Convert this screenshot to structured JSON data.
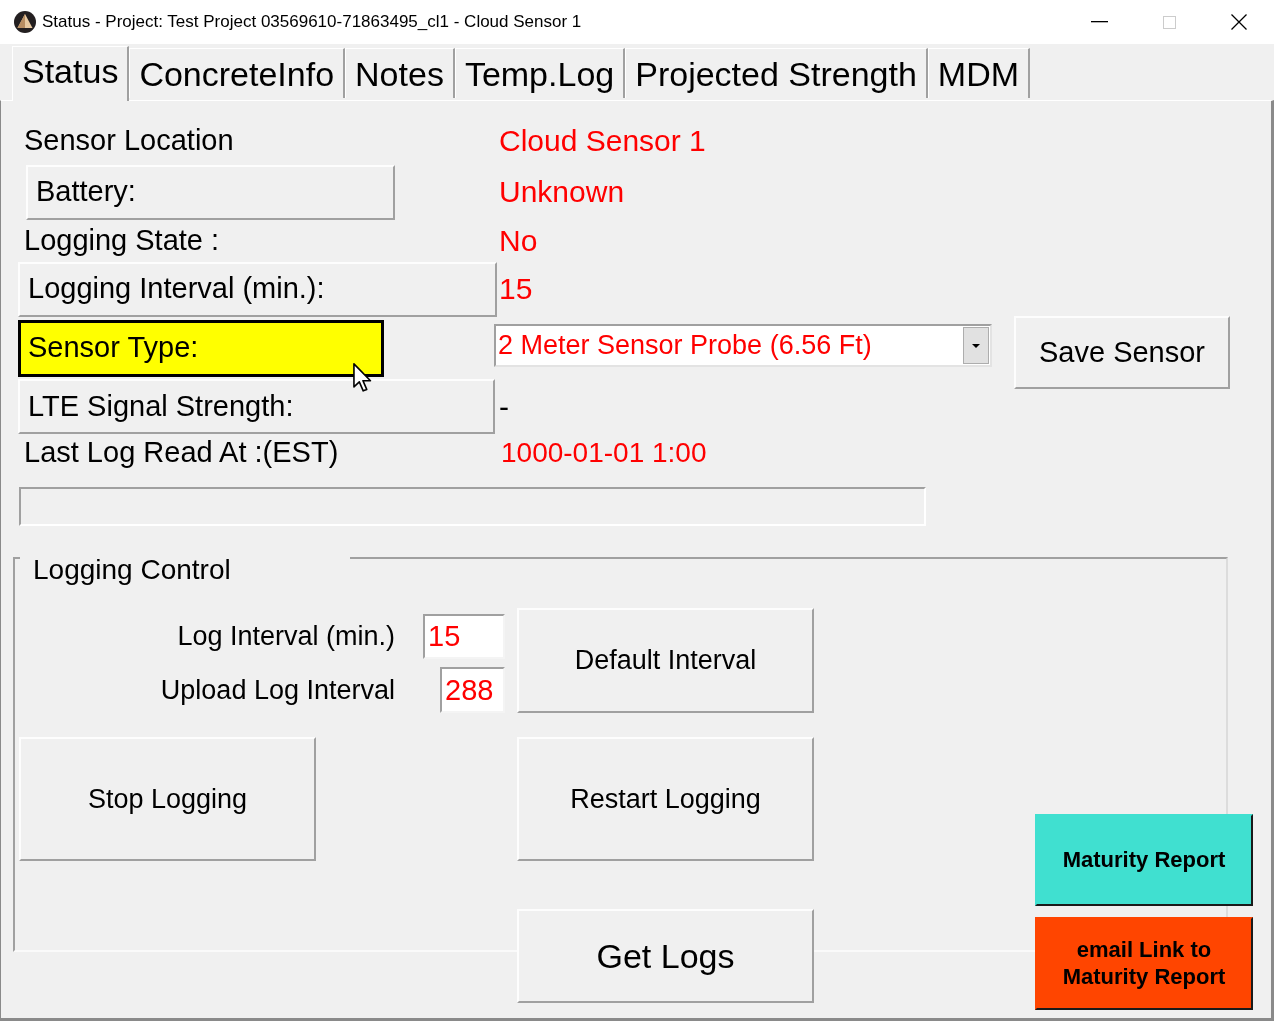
{
  "window": {
    "title": "Status - Project: Test Project 03569610-71863495_cl1 - Cloud Sensor 1",
    "maximize": {
      "disabled": true
    }
  },
  "tabs": [
    {
      "label": "Status",
      "selected": true
    },
    {
      "label": "ConcreteInfo",
      "selected": false
    },
    {
      "label": "Notes",
      "selected": false
    },
    {
      "label": "Temp.Log",
      "selected": false
    },
    {
      "label": "Projected Strength",
      "selected": false
    },
    {
      "label": "MDM",
      "selected": false
    }
  ],
  "sensor_rows": [
    {
      "kind": "text",
      "label": "Sensor Location",
      "value": "Cloud Sensor 1",
      "color": "#ff0000"
    },
    {
      "kind": "button",
      "label": "Battery:",
      "highlighted": false,
      "value": "Unknown",
      "color": "#ff0000"
    },
    {
      "kind": "text",
      "label": "Logging State :",
      "value": "No",
      "color": "#ff0000"
    },
    {
      "kind": "button",
      "label": "Logging Interval (min.):",
      "highlighted": false,
      "value": "15",
      "color": "#ff0000"
    },
    {
      "kind": "button",
      "label": "Sensor Type:",
      "highlighted": true,
      "dropdown": {
        "value": "2 Meter Sensor Probe (6.56 Ft)"
      }
    },
    {
      "kind": "button",
      "label": "LTE Signal Strength:",
      "highlighted": false,
      "value": "-",
      "color": "#000000"
    },
    {
      "kind": "text",
      "label": "Last Log Read At :(EST)",
      "value": "1000-01-01 1:00",
      "color": "#ff0000"
    }
  ],
  "save_button": "Save Sensor",
  "logging_control": {
    "title": "Logging Control",
    "fields": [
      {
        "label": "Log Interval (min.)",
        "value": "15"
      },
      {
        "label": "Upload Log Interval",
        "value": "288"
      }
    ],
    "default_button": "Default Interval",
    "stop_button": "Stop Logging",
    "restart_button": "Restart Logging",
    "get_logs_button": "Get Logs"
  },
  "report_buttons": [
    {
      "label": "Maturity Report",
      "color": "#40e0d0"
    },
    {
      "label": "email Link to Maturity Report",
      "color": "#ff4500"
    }
  ]
}
